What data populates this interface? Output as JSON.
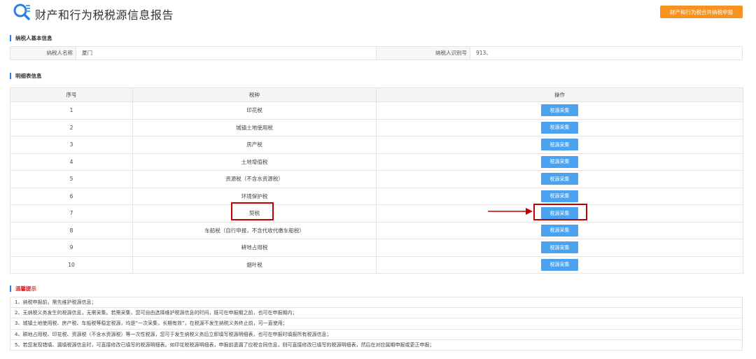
{
  "header": {
    "title": "财产和行为税税源信息报告",
    "top_button_label": "财产和行为税合并纳税申报"
  },
  "taxpayer_section": {
    "title": "纳税人基本信息",
    "name_label": "纳税人名称",
    "name_value": "厦门",
    "id_label": "纳税人识别号",
    "id_value": "913、"
  },
  "detail_section": {
    "title": "明细表信息",
    "columns": [
      "序号",
      "税种",
      "操作"
    ],
    "rows": [
      {
        "no": "1",
        "tax": "印花税",
        "action": "税源采集"
      },
      {
        "no": "2",
        "tax": "城镇土地使用税",
        "action": "税源采集"
      },
      {
        "no": "3",
        "tax": "房产税",
        "action": "税源采集"
      },
      {
        "no": "4",
        "tax": "土地增值税",
        "action": "税源采集"
      },
      {
        "no": "5",
        "tax": "资源税（不含水资源税）",
        "action": "税源采集"
      },
      {
        "no": "6",
        "tax": "环境保护税",
        "action": "税源采集"
      },
      {
        "no": "7",
        "tax": "契税",
        "action": "税源采集"
      },
      {
        "no": "8",
        "tax": "车船税（自行申报，不含代收代缴车船税）",
        "action": "税源采集"
      },
      {
        "no": "9",
        "tax": "耕地占用税",
        "action": "税源采集"
      },
      {
        "no": "10",
        "tax": "烟叶税",
        "action": "税源采集"
      }
    ]
  },
  "tips_section": {
    "title": "温馨提示",
    "items": [
      "1、纳税申报前，需先维护税源信息；",
      "2、无纳税义务发生的税源信息，无需采集。若需采集，您可自由选择维护税源信息的时间，既可在申报期之前，也可在申报期内；",
      "3、城镇土地使用税、房产税、车船税等稳定税源，均是“一次采集，长期有效”，在税源不发生纳税义务终止前，可一直使用；",
      "4、耕地占用税、印花税、资源税（不含水资源税）等一次性税源，您可于发生纳税义务后立即填写税源明细表，也可在申报时填报所有税源信息；",
      "5、若您发现错填、漏填税源信息时，可直接修改已填写的税源明细表。如印花税税源明细表，申报前遗漏了应税合同信息，则可直接修改已填写的税源明细表，然后在对应属期申报或更正申报；"
    ]
  },
  "colors": {
    "accent_blue": "#4aa3f0",
    "top_button": "#f7931e",
    "highlight_red": "#c00000"
  }
}
